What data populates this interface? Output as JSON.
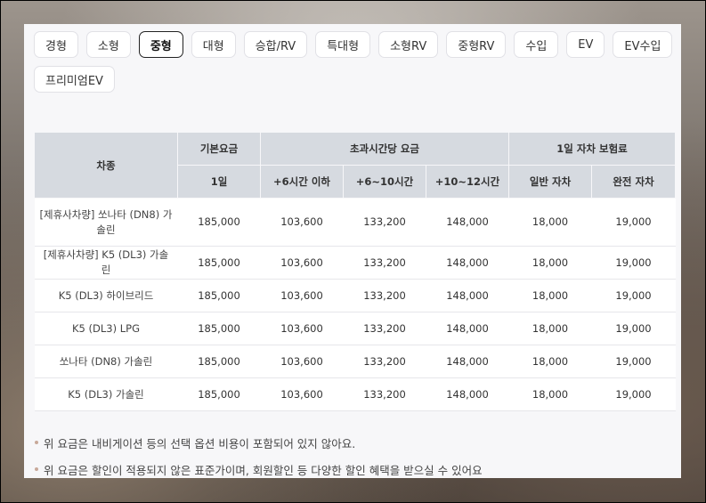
{
  "tabs": [
    {
      "label": "경형",
      "active": false
    },
    {
      "label": "소형",
      "active": false
    },
    {
      "label": "중형",
      "active": true
    },
    {
      "label": "대형",
      "active": false
    },
    {
      "label": "승합/RV",
      "active": false
    },
    {
      "label": "특대형",
      "active": false
    },
    {
      "label": "소형RV",
      "active": false
    },
    {
      "label": "중형RV",
      "active": false
    },
    {
      "label": "수입",
      "active": false
    },
    {
      "label": "EV",
      "active": false
    },
    {
      "label": "EV수입",
      "active": false
    },
    {
      "label": "프리미엄EV",
      "active": false
    }
  ],
  "table": {
    "header": {
      "car": "차종",
      "base": "기본요금",
      "overtime": "초과시간당 요금",
      "insurance": "1일 자차 보험료",
      "day": "1일",
      "h6": "+6시간 이하",
      "h6_10": "+6~10시간",
      "h10_12": "+10~12시간",
      "normal": "일반 자차",
      "full": "완전 자차"
    },
    "rows": [
      {
        "name": "[제휴사차량] 쏘나타 (DN8) 가솔린",
        "day": "185,000",
        "h6": "103,600",
        "h6_10": "133,200",
        "h10_12": "148,000",
        "normal": "18,000",
        "full": "19,000"
      },
      {
        "name": "[제휴사차량] K5 (DL3) 가솔린",
        "day": "185,000",
        "h6": "103,600",
        "h6_10": "133,200",
        "h10_12": "148,000",
        "normal": "18,000",
        "full": "19,000"
      },
      {
        "name": "K5 (DL3) 하이브리드",
        "day": "185,000",
        "h6": "103,600",
        "h6_10": "133,200",
        "h10_12": "148,000",
        "normal": "18,000",
        "full": "19,000"
      },
      {
        "name": "K5 (DL3) LPG",
        "day": "185,000",
        "h6": "103,600",
        "h6_10": "133,200",
        "h10_12": "148,000",
        "normal": "18,000",
        "full": "19,000"
      },
      {
        "name": "쏘나타 (DN8) 가솔린",
        "day": "185,000",
        "h6": "103,600",
        "h6_10": "133,200",
        "h10_12": "148,000",
        "normal": "18,000",
        "full": "19,000"
      },
      {
        "name": "K5 (DL3) 가솔린",
        "day": "185,000",
        "h6": "103,600",
        "h6_10": "133,200",
        "h10_12": "148,000",
        "normal": "18,000",
        "full": "19,000"
      }
    ]
  },
  "notes": [
    "위 요금은 내비게이션 등의 선택 옵션 비용이 포함되어 있지 않아요.",
    "위 요금은 할인이 적용되지 않은 표준가이며, 회원할인 등 다양한 할인 혜택을 받으실 수 있어요"
  ]
}
